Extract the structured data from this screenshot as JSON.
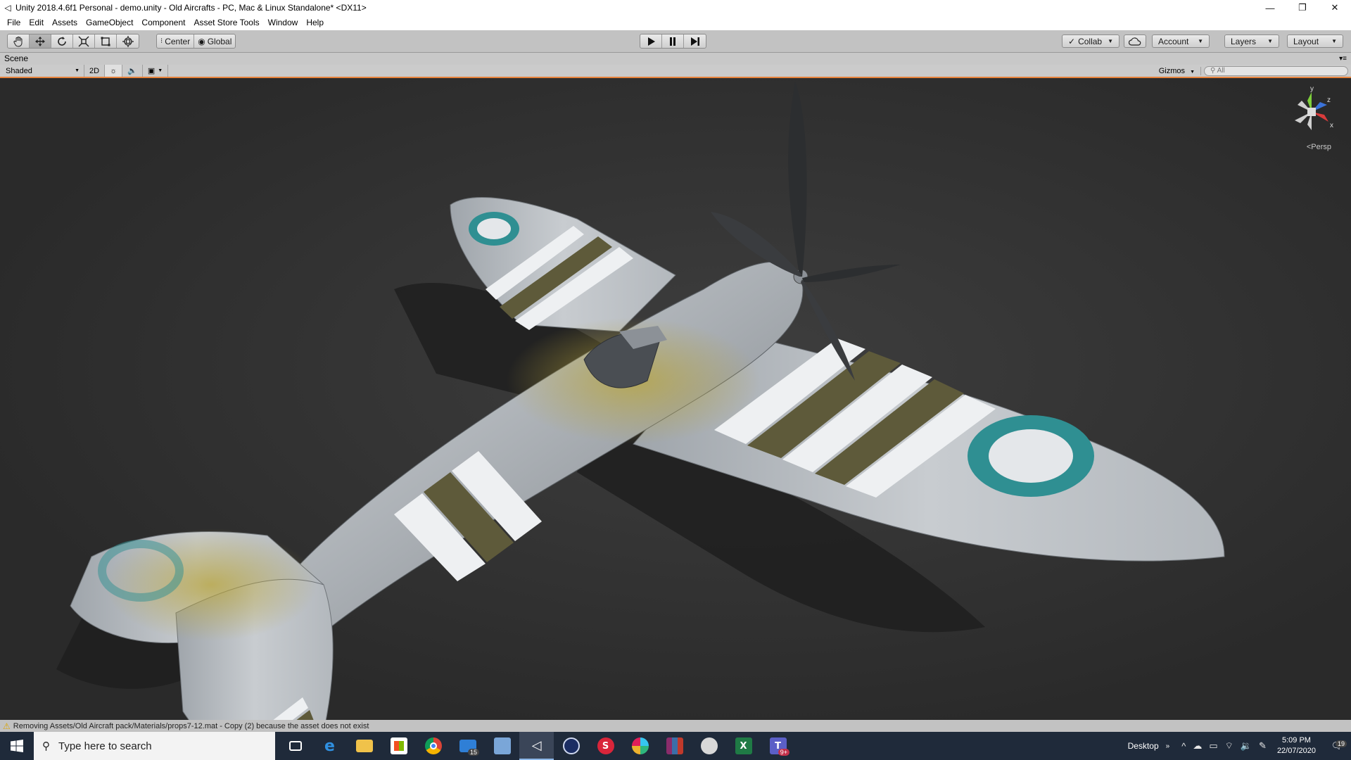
{
  "window": {
    "title": "Unity 2018.4.6f1 Personal - demo.unity - Old Aircrafts - PC, Mac & Linux Standalone* <DX11>",
    "controls": {
      "minimize": "—",
      "restore": "❐",
      "close": "✕"
    }
  },
  "menu": [
    "File",
    "Edit",
    "Assets",
    "GameObject",
    "Component",
    "Asset Store Tools",
    "Window",
    "Help"
  ],
  "toolbar": {
    "tools": [
      "hand-tool",
      "move-tool",
      "rotate-tool",
      "scale-tool",
      "rect-tool",
      "transform-tool"
    ],
    "active_tool": "move-tool",
    "pivot_center": "Center",
    "pivot_global": "Global",
    "collab": "Collab",
    "account": "Account",
    "layers": "Layers",
    "layout": "Layout"
  },
  "scene": {
    "tab_label": "Scene",
    "shading": "Shaded",
    "mode_2d": "2D",
    "gizmos": "Gizmos",
    "search_placeholder": "All",
    "projection": "Persp",
    "gizmo_axes": {
      "y": "y",
      "z": "z",
      "x": "x"
    }
  },
  "status": {
    "message": "Removing Assets/Old Aircraft pack/Materials/props7-12.mat - Copy (2) because the asset does not exist",
    "level": "warning"
  },
  "taskbar": {
    "search_placeholder": "Type here to search",
    "apps": [
      {
        "name": "task-view",
        "label": ""
      },
      {
        "name": "edge",
        "label": "e"
      },
      {
        "name": "file-explorer",
        "label": ""
      },
      {
        "name": "store",
        "label": ""
      },
      {
        "name": "chrome",
        "label": ""
      },
      {
        "name": "mail",
        "label": "",
        "badge": "15"
      },
      {
        "name": "network-app",
        "label": ""
      },
      {
        "name": "unity",
        "label": ""
      },
      {
        "name": "cinema4d",
        "label": ""
      },
      {
        "name": "substance",
        "label": "S"
      },
      {
        "name": "slack",
        "label": ""
      },
      {
        "name": "winrar",
        "label": ""
      },
      {
        "name": "paint",
        "label": ""
      },
      {
        "name": "excel",
        "label": "X"
      },
      {
        "name": "teams",
        "label": "T",
        "badge": "9+"
      }
    ],
    "desktop_label": "Desktop",
    "time": "5:09 PM",
    "date": "22/07/2020",
    "notifications": "19"
  },
  "colors": {
    "accent_orange": "#e7813a",
    "unity_toolbar": "#c2c2c2",
    "taskbar": "#1f2a3a"
  }
}
